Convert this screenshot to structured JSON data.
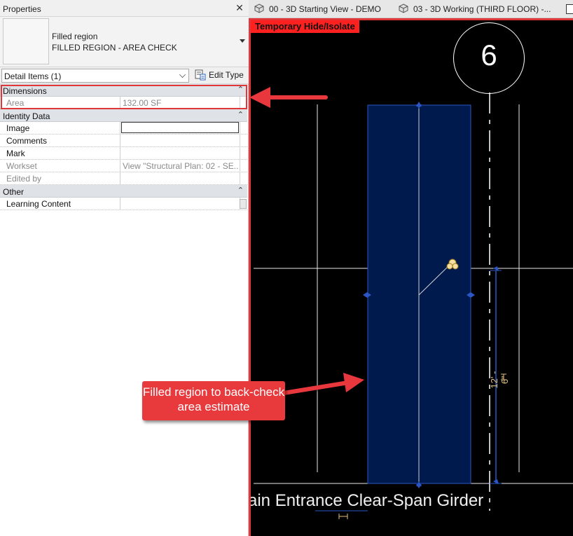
{
  "properties": {
    "title": "Properties",
    "close_glyph": "✕",
    "type_family": "Filled region",
    "type_name": "FILLED REGION - AREA CHECK",
    "filter_value": "Detail Items (1)",
    "edit_type_label": "Edit Type",
    "categories": [
      {
        "label": "Dimensions"
      },
      {
        "label": "Identity Data"
      },
      {
        "label": "Other"
      }
    ],
    "collapse_glyph": "⌃",
    "rows": {
      "area": {
        "name": "Area",
        "value": "132.00 SF"
      },
      "image": {
        "name": "Image",
        "value": ""
      },
      "comments": {
        "name": "Comments",
        "value": ""
      },
      "mark": {
        "name": "Mark",
        "value": ""
      },
      "workset": {
        "name": "Workset",
        "value": "View \"Structural Plan: 02 - SE..."
      },
      "edited_by": {
        "name": "Edited by",
        "value": ""
      },
      "learning_content": {
        "name": "Learning Content",
        "value": ""
      }
    }
  },
  "tabs": [
    {
      "label": "00 - 3D Starting View - DEMO"
    },
    {
      "label": "03 - 3D Working (THIRD FLOOR) -..."
    }
  ],
  "view": {
    "temp_hide_label": "Temporary Hide/Isolate",
    "grid_bubble_number": "6",
    "dimension_text": "12' - 6\"",
    "girder_label": "ain Entrance Clear-Span Girder"
  },
  "annotations": {
    "callout_text": "Filled region to back-check area estimate"
  },
  "colors": {
    "highlight_red": "#e0373b",
    "filled_region": "#001a4d",
    "filled_region_edge": "#2a56c6",
    "dimension_color": "#e0c080"
  }
}
